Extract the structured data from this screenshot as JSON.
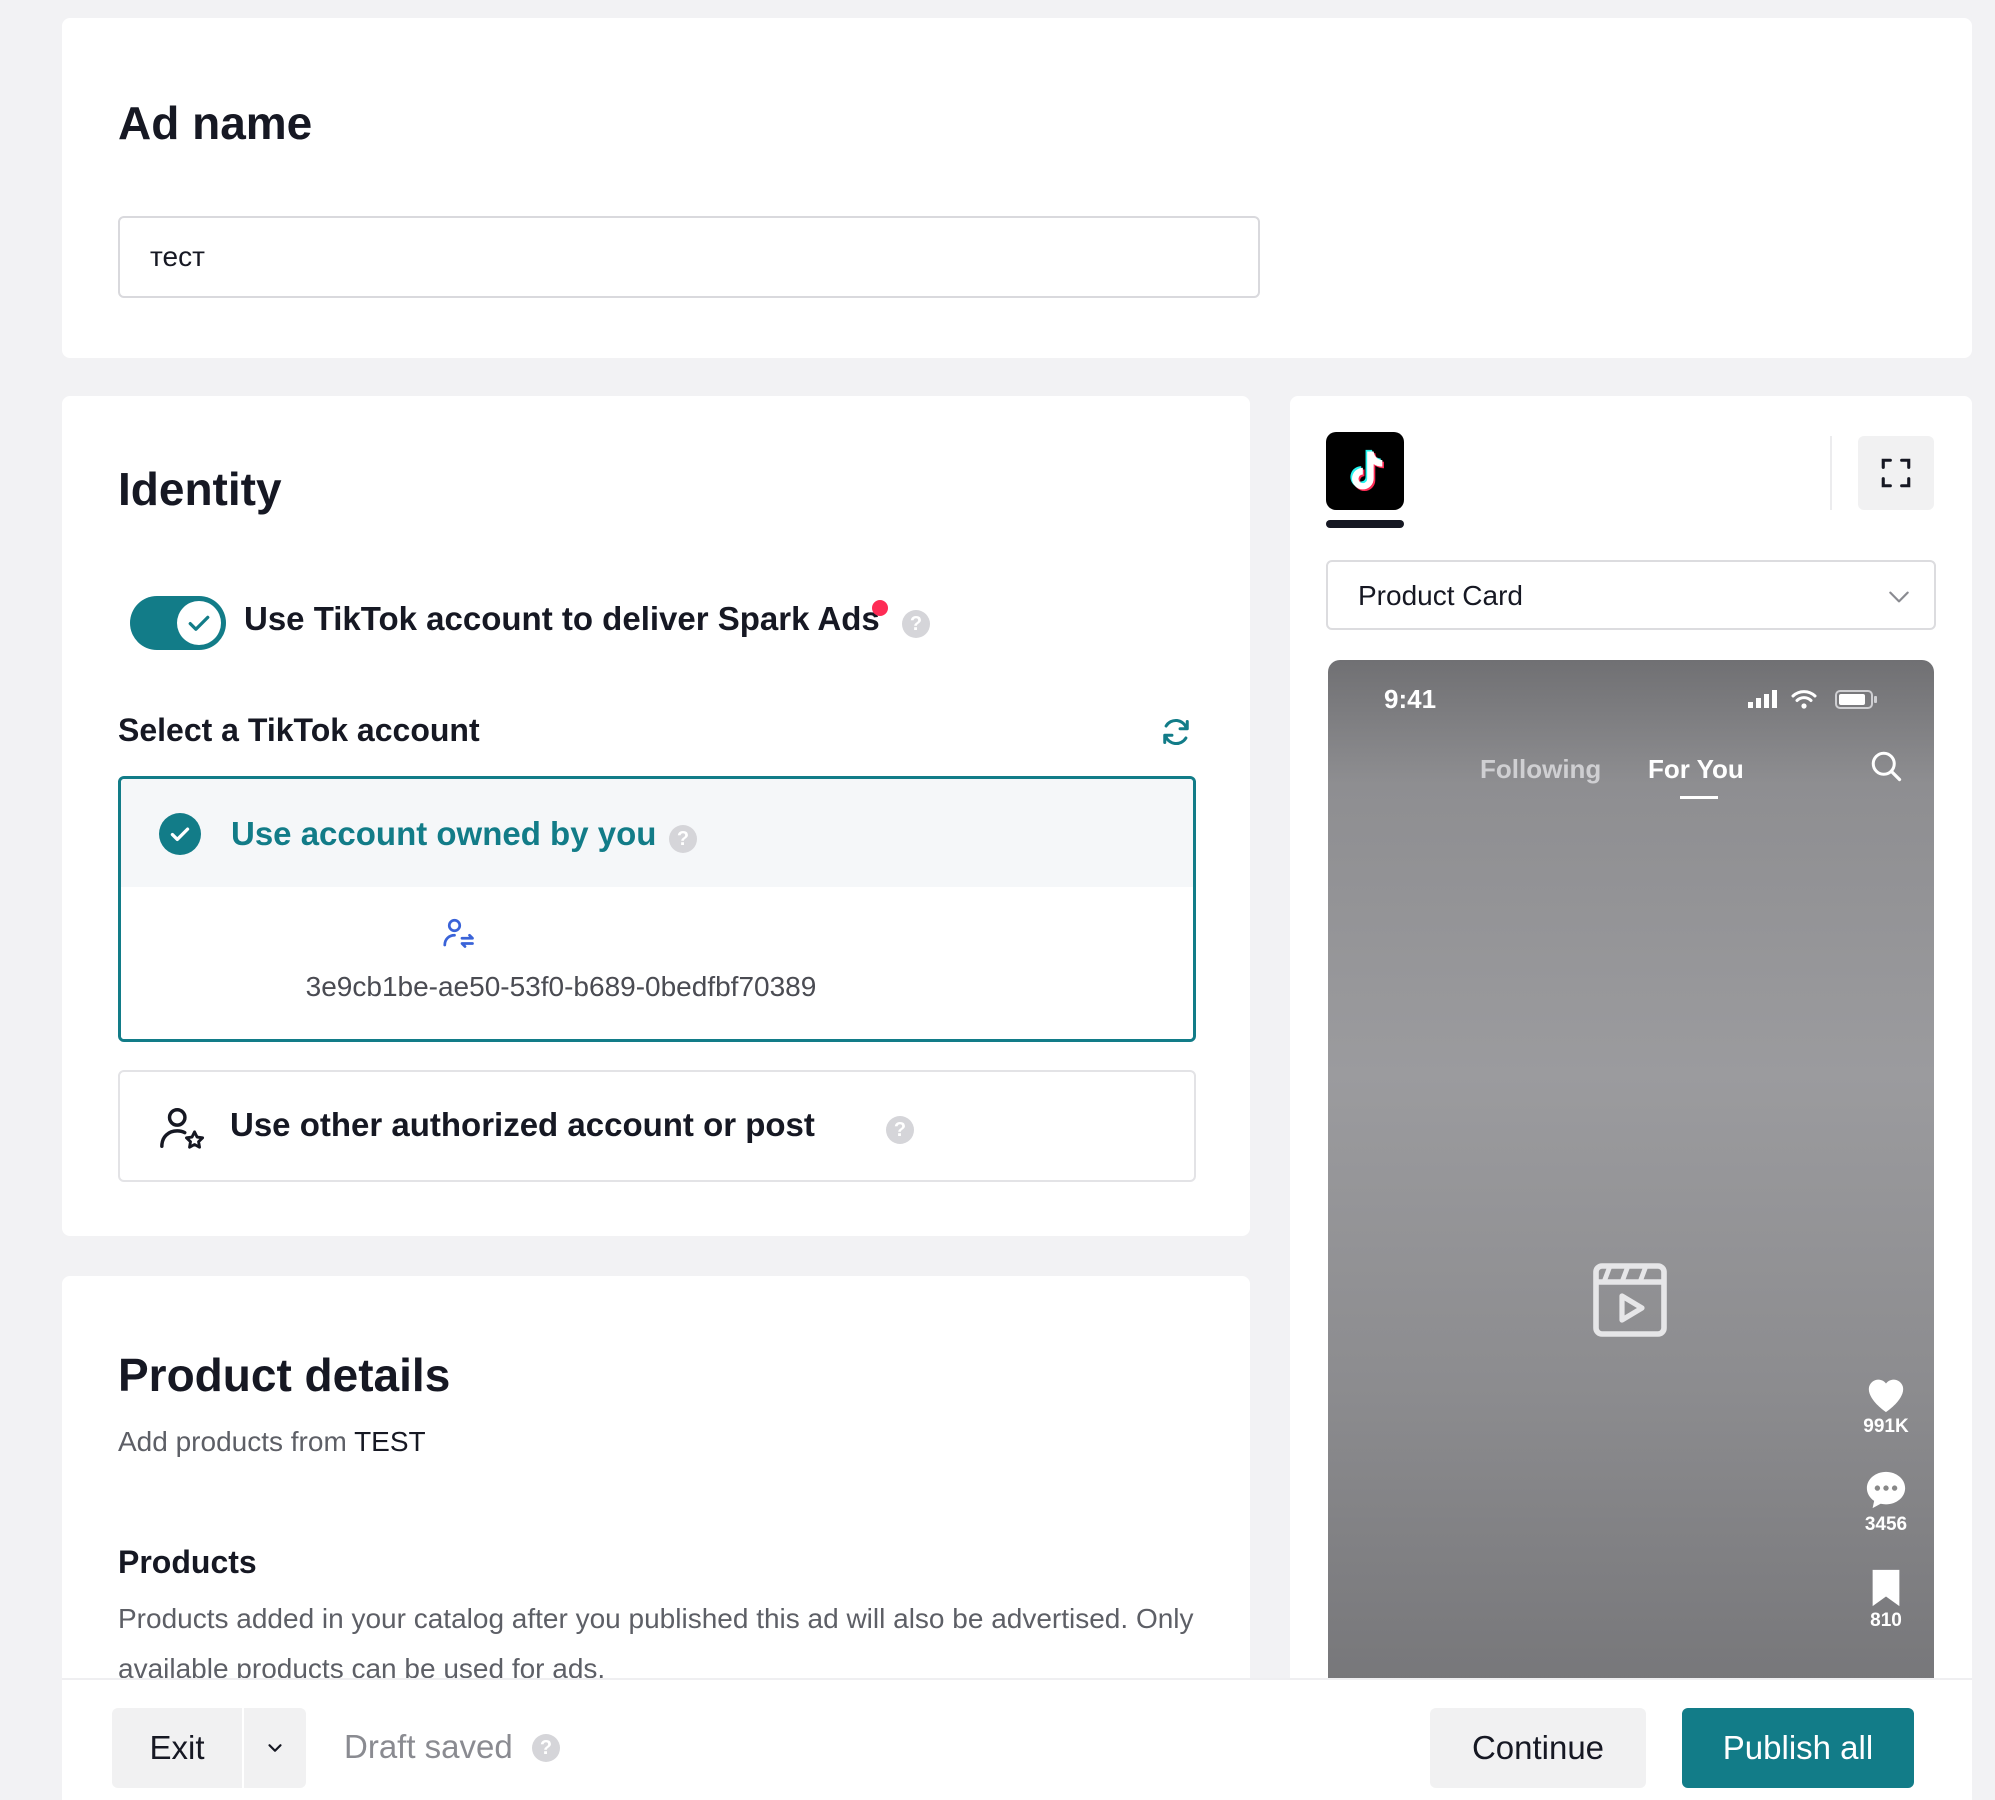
{
  "ad_name": {
    "title": "Ad name",
    "value": "тест"
  },
  "identity": {
    "title": "Identity",
    "spark_toggle_label": "Use TikTok account to deliver Spark Ads",
    "spark_toggle_on": true,
    "select_account_label": "Select a TikTok account",
    "owned_account_label": "Use account owned by you",
    "account_id": "3e9cb1be-ae50-53f0-b689-0bedfbf70389",
    "other_account_label": "Use other authorized account or post"
  },
  "product_details": {
    "title": "Product details",
    "subtitle_prefix": "Add products from",
    "subtitle_source": "TEST",
    "products_heading": "Products",
    "products_description": "Products added in your catalog after you published this ad will also be advertised. Only available products can be used for ads."
  },
  "preview": {
    "placement": "Product Card",
    "phone": {
      "time": "9:41",
      "tab_following": "Following",
      "tab_for_you": "For You",
      "likes": "991K",
      "comments": "3456",
      "saves": "810"
    }
  },
  "bottom_bar": {
    "exit_label": "Exit",
    "draft_status": "Draft saved",
    "continue_label": "Continue",
    "publish_label": "Publish all"
  },
  "colors": {
    "accent": "#127c88",
    "notification": "#fe2c55",
    "background": "#f2f2f4"
  },
  "icons": [
    "check-icon",
    "help-icon",
    "refresh-icon",
    "account-switch-icon",
    "user-star-icon",
    "tiktok-logo-icon",
    "fullscreen-icon",
    "chevron-down-icon",
    "search-icon",
    "video-icon",
    "heart-icon",
    "comment-icon",
    "bookmark-icon"
  ]
}
